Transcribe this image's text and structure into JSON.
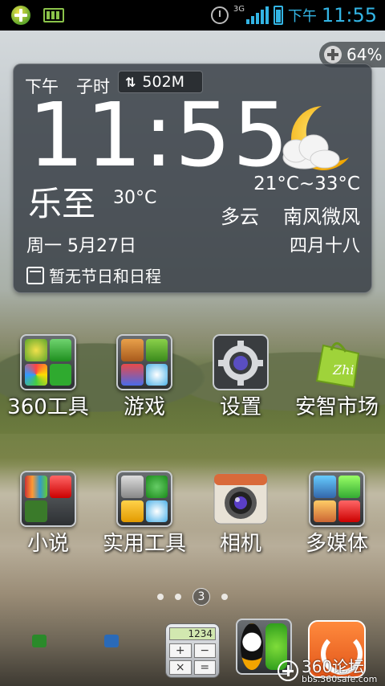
{
  "status_bar": {
    "network": "3G",
    "ampm": "下午",
    "time": "11:55"
  },
  "memory_widget": {
    "percent": "64%",
    "icon": "plus-circle-icon"
  },
  "weather_widget": {
    "ampm": "下午",
    "shichen": "子时",
    "traffic_icon": "up-down-arrows-icon",
    "traffic_value": "502M",
    "time": "11:55",
    "solar_term": "乐至",
    "current_temp": "30°C",
    "temp_range": "21°C~33°C",
    "condition": "多云",
    "wind": "南风微风",
    "date": "周一 5月27日",
    "lunar_date": "四月十八",
    "schedule": "暂无节日和日程",
    "weather_icon": "moon-cloud-icon"
  },
  "desktop": {
    "row1": [
      {
        "label": "360工具",
        "icon": "folder-icon"
      },
      {
        "label": "游戏",
        "icon": "folder-icon"
      },
      {
        "label": "设置",
        "icon": "gear-icon"
      },
      {
        "label": "安智市场",
        "icon": "shopping-bag-icon"
      }
    ],
    "row2": [
      {
        "label": "小说",
        "icon": "folder-icon"
      },
      {
        "label": "实用工具",
        "icon": "folder-icon"
      },
      {
        "label": "相机",
        "icon": "camera-icon"
      },
      {
        "label": "多媒体",
        "icon": "folder-icon"
      }
    ]
  },
  "pager": {
    "current_page": "3"
  },
  "dock": {
    "calculator_display": "1234",
    "calculator_keys": [
      "+",
      "−",
      "×",
      "="
    ]
  },
  "watermark": {
    "title": "360论坛",
    "url": "bbs.360safe.com"
  },
  "colors": {
    "accent": "#33b5e5",
    "widget_bg": "#343a42",
    "uc_orange": "#ff8a3d"
  }
}
